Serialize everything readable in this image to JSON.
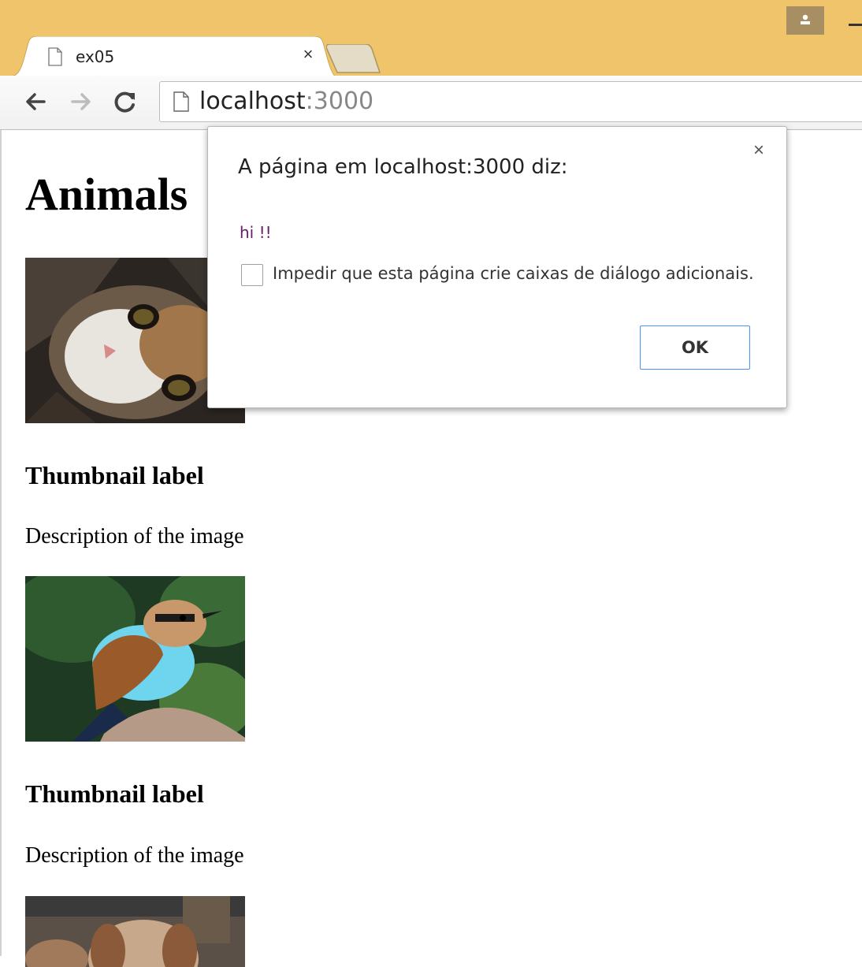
{
  "browser": {
    "tab": {
      "title": "ex05",
      "close_glyph": "×"
    },
    "address": {
      "host": "localhost",
      "port": ":3000"
    },
    "icons": [
      "page-icon",
      "back-arrow-icon",
      "forward-arrow-icon",
      "reload-icon",
      "profile-icon"
    ]
  },
  "page": {
    "title": "Animals",
    "thumbnails": [
      {
        "image": "cat-photo",
        "label": "Thumbnail label",
        "description": "Description of the image"
      },
      {
        "image": "bird-photo",
        "label": "Thumbnail label",
        "description": "Description of the image"
      },
      {
        "image": "dog-photo"
      }
    ]
  },
  "dialog": {
    "title": "A página em localhost:3000 diz:",
    "message": "hi !!",
    "checkbox_label": "Impedir que esta página crie caixas de diálogo adicionais.",
    "ok_label": "OK",
    "close_glyph": "×",
    "accent_color": "#4d90fe"
  },
  "colors": {
    "titlebar": "#f0c46a",
    "dialog_message": "#6a1a6a"
  }
}
